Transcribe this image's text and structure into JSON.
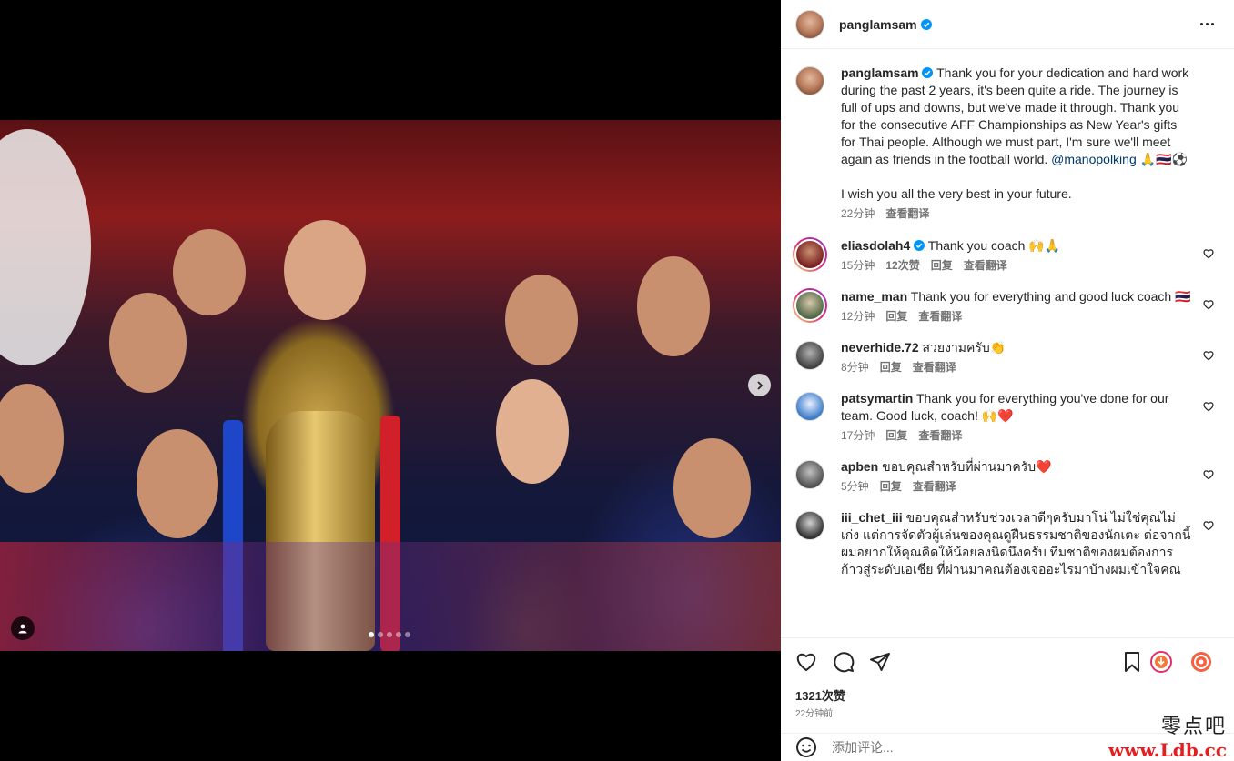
{
  "post": {
    "author": "panglamsam",
    "caption": {
      "p1": "Thank you for your dedication and hard work during the past 2 years, it's been quite a ride. The journey is full of ups and downs, but we've made it through. Thank you for the consecutive AFF Championships as New Year's gifts for Thai people. Although we must part, I'm sure we'll meet again as friends in the football world.",
      "mention": "@manopolking",
      "emoji": "🙏🇹🇭⚽",
      "p2": "I wish you all the very best in your future.",
      "time": "22分钟",
      "translate": "查看翻译"
    },
    "carousel": {
      "count": 5,
      "active_index": 0
    },
    "likes": "1321次赞",
    "posted": "22分钟前",
    "comment_placeholder": "添加评论..."
  },
  "comments": [
    {
      "user": "eliasdolah4",
      "verified": true,
      "text": "Thank you coach 🙌🙏",
      "time": "15分钟",
      "likes": "12次赞",
      "reply": "回复",
      "translate": "查看翻译",
      "story_ring": true
    },
    {
      "user": "name_man",
      "verified": false,
      "text": "Thank you for everything and good luck coach 🇹🇭",
      "time": "12分钟",
      "reply": "回复",
      "translate": "查看翻译",
      "story_ring": true
    },
    {
      "user": "neverhide.72",
      "verified": false,
      "text": "สวยงามครับ👏",
      "time": "8分钟",
      "reply": "回复",
      "translate": "查看翻译",
      "story_ring": false
    },
    {
      "user": "patsymartin",
      "verified": false,
      "text": "Thank you for everything you've done for our team. Good luck, coach! 🙌❤️",
      "time": "17分钟",
      "reply": "回复",
      "translate": "查看翻译",
      "story_ring": false
    },
    {
      "user": "apben",
      "verified": false,
      "text": "ขอบคุณสำหรับที่ผ่านมาครับ❤️",
      "time": "5分钟",
      "reply": "回复",
      "translate": "查看翻译",
      "story_ring": false
    },
    {
      "user": "iii_chet_iii",
      "verified": false,
      "text": "ขอบคุณสำหรับช่วงเวลาดีๆครับมาโน่ ไม่ใช่คุณไม่เก่ง แต่การจัดตัวผู้เล่นของคุณดูฝืนธรรมชาติของนักเตะ ต่อจากนี้ผมอยากให้คุณคิดให้น้อยลงนิดนึงครับ ทีมชาติของผมต้องการก้าวสู่ระดับเอเชีย ที่ผ่านมาคณต้องเจออะไรมาบ้างผมเข้าใจคณ",
      "story_ring": false
    }
  ],
  "icons": {
    "like": "heart-icon",
    "comment": "comment-icon",
    "share": "send-icon",
    "save": "bookmark-icon",
    "emoji": "emoji-icon",
    "more": "more-icon"
  },
  "watermark": {
    "cn": "零点吧",
    "url": "www.Ldb.cc"
  },
  "colors": {
    "verified": "#0095f6",
    "mention": "#00376b",
    "meta": "#737373"
  }
}
